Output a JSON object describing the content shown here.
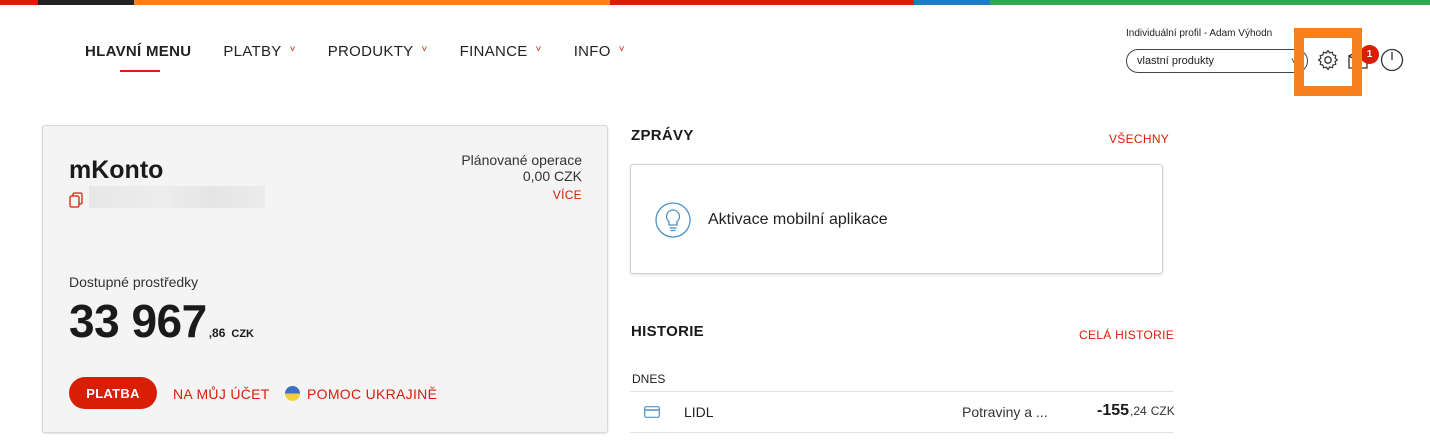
{
  "strip_colors": [
    "#d81e05",
    "#222222",
    "#f68121",
    "#d81e05",
    "#1e7bc6",
    "#2fa84f"
  ],
  "nav": {
    "items": [
      {
        "label": "HLAVNÍ MENU",
        "active": true
      },
      {
        "label": "PLATBY",
        "active": false
      },
      {
        "label": "PRODUKTY",
        "active": false
      },
      {
        "label": "FINANCE",
        "active": false
      },
      {
        "label": "INFO",
        "active": false
      }
    ]
  },
  "profile": {
    "label": "Individuální profil - Adam Výhodn",
    "select_value": "vlastní produkty",
    "notification_count": "1",
    "icons": [
      "gear-icon",
      "mail-icon",
      "power-icon"
    ]
  },
  "account": {
    "name": "mKonto",
    "planned_label": "Plánované operace",
    "planned_value": "0,00 CZK",
    "more_label": "VÍCE",
    "available_label": "Dostupné prostředky",
    "balance_int": "33 967",
    "balance_dec": ",86",
    "balance_currency": "CZK",
    "pay_button": "PLATBA",
    "own_account_link": "NA MŮJ ÚČET",
    "ukraine_link": "POMOC UKRAJINĚ"
  },
  "messages": {
    "title": "ZPRÁVY",
    "all_link": "VŠECHNY",
    "item_text": "Aktivace mobilní aplikace"
  },
  "history": {
    "title": "HISTORIE",
    "all_link": "CELÁ HISTORIE",
    "day_label": "DNES",
    "rows": [
      {
        "name": "LIDL",
        "category": "Potraviny a ...",
        "amount_int": "-155",
        "amount_dec": ",24",
        "currency": "CZK"
      }
    ]
  },
  "colors": {
    "accent": "#d81e05",
    "highlight": "#f68121"
  }
}
